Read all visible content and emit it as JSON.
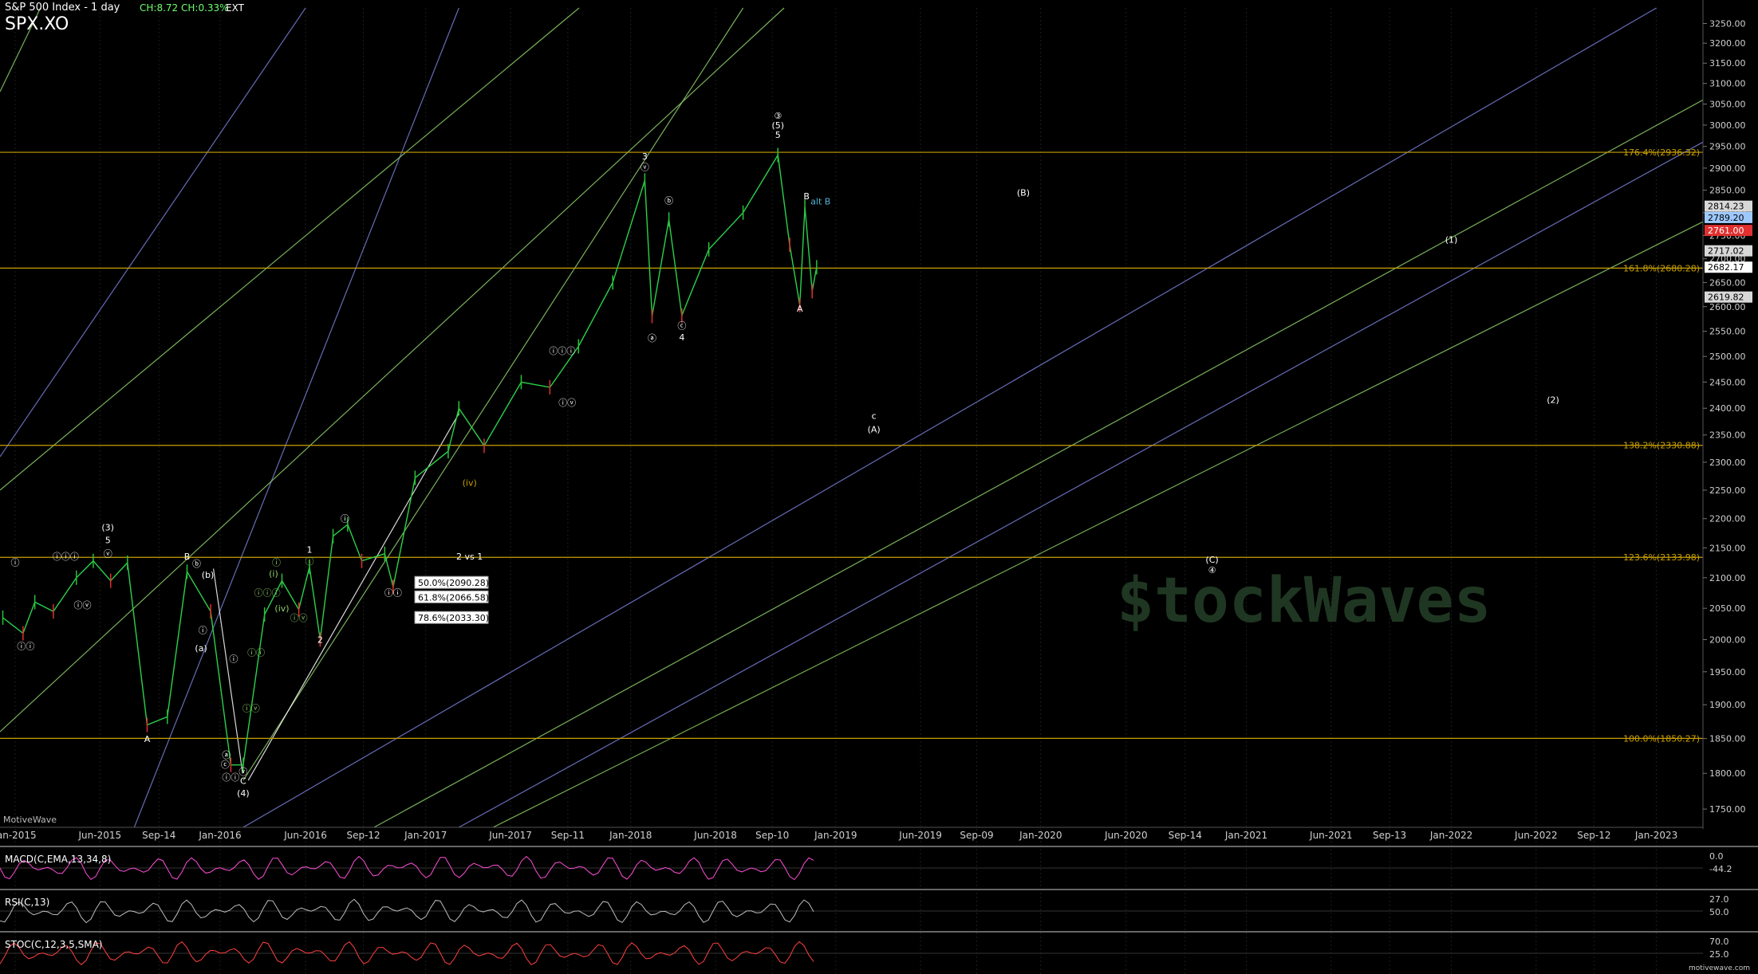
{
  "header": {
    "title": "S&P 500 Index - 1 day",
    "symbol": "SPX.XO",
    "change_points": "CH:8.72",
    "change_pct": "CH:0.33%",
    "session": "EXT"
  },
  "brand_label": "MotiveWave",
  "watermark_text": "motivewave.com",
  "logo_text": "$tockWaves",
  "colors": {
    "background": "#000000",
    "fib_line": "#c8a000",
    "up_bar": "#27c23a",
    "down_bar": "#e03030",
    "channel_green": "#8fd06a",
    "channel_blue": "#7a7fd8",
    "macd_line": "#ff4fd8",
    "macd_signal": "#4fa9ff",
    "rsi_line": "#bdbdbd",
    "stoch_line": "#ff4040"
  },
  "chart_data": {
    "type": "line",
    "title": "S&P 500 Index - 1 day",
    "y_scale": "log",
    "ylim": [
      1725,
      3290
    ],
    "xlim": [
      "2014-12-05",
      "2023-03-25"
    ],
    "y_ticks": [
      "3250.00",
      "3200.00",
      "3150.00",
      "3100.00",
      "3050.00",
      "3000.00",
      "2950.00",
      "2900.00",
      "2850.00",
      "2800.00",
      "2750.00",
      "2700.00",
      "2650.00",
      "2600.00",
      "2550.00",
      "2500.00",
      "2450.00",
      "2400.00",
      "2350.00",
      "2300.00",
      "2250.00",
      "2200.00",
      "2150.00",
      "2100.00",
      "2050.00",
      "2000.00",
      "1950.00",
      "1900.00",
      "1850.00",
      "1800.00",
      "1750.00"
    ],
    "x_ticks": [
      {
        "date": "2015-01-01",
        "label": "Jan-2015"
      },
      {
        "date": "2015-06-01",
        "label": "Jun-2015"
      },
      {
        "date": "2015-09-14",
        "label": "Sep-14"
      },
      {
        "date": "2016-01-01",
        "label": "Jan-2016"
      },
      {
        "date": "2016-06-01",
        "label": "Jun-2016"
      },
      {
        "date": "2016-09-12",
        "label": "Sep-12"
      },
      {
        "date": "2017-01-01",
        "label": "Jan-2017"
      },
      {
        "date": "2017-06-01",
        "label": "Jun-2017"
      },
      {
        "date": "2017-09-11",
        "label": "Sep-11"
      },
      {
        "date": "2018-01-01",
        "label": "Jan-2018"
      },
      {
        "date": "2018-06-01",
        "label": "Jun-2018"
      },
      {
        "date": "2018-09-10",
        "label": "Sep-10"
      },
      {
        "date": "2019-01-01",
        "label": "Jan-2019"
      },
      {
        "date": "2019-06-01",
        "label": "Jun-2019"
      },
      {
        "date": "2019-09-09",
        "label": "Sep-09"
      },
      {
        "date": "2020-01-01",
        "label": "Jan-2020"
      },
      {
        "date": "2020-06-01",
        "label": "Jun-2020"
      },
      {
        "date": "2020-09-14",
        "label": "Sep-14"
      },
      {
        "date": "2021-01-01",
        "label": "Jan-2021"
      },
      {
        "date": "2021-06-01",
        "label": "Jun-2021"
      },
      {
        "date": "2021-09-13",
        "label": "Sep-13"
      },
      {
        "date": "2022-01-01",
        "label": "Jan-2022"
      },
      {
        "date": "2022-06-01",
        "label": "Jun-2022"
      },
      {
        "date": "2022-09-12",
        "label": "Sep-12"
      },
      {
        "date": "2023-01-01",
        "label": "Jan-2023"
      }
    ],
    "price_series": [
      {
        "date": "2014-12-10",
        "value": 2035
      },
      {
        "date": "2015-01-15",
        "value": 2010
      },
      {
        "date": "2015-02-05",
        "value": 2060
      },
      {
        "date": "2015-03-10",
        "value": 2045
      },
      {
        "date": "2015-04-20",
        "value": 2100
      },
      {
        "date": "2015-05-20",
        "value": 2128
      },
      {
        "date": "2015-06-20",
        "value": 2095
      },
      {
        "date": "2015-07-20",
        "value": 2125
      },
      {
        "date": "2015-08-24",
        "value": 1870
      },
      {
        "date": "2015-09-29",
        "value": 1882
      },
      {
        "date": "2015-11-03",
        "value": 2110
      },
      {
        "date": "2015-12-15",
        "value": 2045
      },
      {
        "date": "2016-01-20",
        "value": 1812
      },
      {
        "date": "2016-02-11",
        "value": 1812
      },
      {
        "date": "2016-03-20",
        "value": 2040
      },
      {
        "date": "2016-04-20",
        "value": 2095
      },
      {
        "date": "2016-05-20",
        "value": 2048
      },
      {
        "date": "2016-06-08",
        "value": 2118
      },
      {
        "date": "2016-06-27",
        "value": 2000
      },
      {
        "date": "2016-07-20",
        "value": 2170
      },
      {
        "date": "2016-08-15",
        "value": 2190
      },
      {
        "date": "2016-09-09",
        "value": 2128
      },
      {
        "date": "2016-10-20",
        "value": 2140
      },
      {
        "date": "2016-11-04",
        "value": 2085
      },
      {
        "date": "2016-12-13",
        "value": 2272
      },
      {
        "date": "2017-02-10",
        "value": 2320
      },
      {
        "date": "2017-03-01",
        "value": 2400
      },
      {
        "date": "2017-04-15",
        "value": 2330
      },
      {
        "date": "2017-06-20",
        "value": 2450
      },
      {
        "date": "2017-08-10",
        "value": 2440
      },
      {
        "date": "2017-09-30",
        "value": 2520
      },
      {
        "date": "2017-11-30",
        "value": 2650
      },
      {
        "date": "2018-01-26",
        "value": 2872
      },
      {
        "date": "2018-02-08",
        "value": 2581
      },
      {
        "date": "2018-03-10",
        "value": 2785
      },
      {
        "date": "2018-04-02",
        "value": 2582
      },
      {
        "date": "2018-05-20",
        "value": 2720
      },
      {
        "date": "2018-07-20",
        "value": 2800
      },
      {
        "date": "2018-09-20",
        "value": 2930
      },
      {
        "date": "2018-10-11",
        "value": 2730
      },
      {
        "date": "2018-10-29",
        "value": 2603
      },
      {
        "date": "2018-11-07",
        "value": 2813
      },
      {
        "date": "2018-11-20",
        "value": 2632
      },
      {
        "date": "2018-11-28",
        "value": 2682
      }
    ],
    "fib_levels": [
      {
        "label": "176.4%(2936.32)",
        "value": 2936.32
      },
      {
        "label": "161.8%(2680.28)",
        "value": 2680.28
      },
      {
        "label": "138.2%(2330.88)",
        "value": 2330.88
      },
      {
        "label": "123.6%(2133.98)",
        "value": 2133.98
      },
      {
        "label": "100.0%(1850.27)",
        "value": 1850.27
      }
    ],
    "retrace_boxes": [
      {
        "label": "50.0%(2090.28)",
        "value": 2090.28
      },
      {
        "label": "61.8%(2066.58)",
        "value": 2066.58
      },
      {
        "label": "78.6%(2033.30)",
        "value": 2033.3
      }
    ],
    "price_tags": [
      {
        "label": "2814.23",
        "value": 2814.23,
        "color": "#d8d8d8",
        "text": "#000"
      },
      {
        "label": "2789.20",
        "value": 2789.2,
        "color": "#9ec9ff",
        "text": "#000"
      },
      {
        "label": "2761.00",
        "value": 2761.0,
        "color": "#e03030",
        "text": "#fff"
      },
      {
        "label": "2717.02",
        "value": 2717.02,
        "color": "#d8d8d8",
        "text": "#000"
      },
      {
        "label": "2682.17",
        "value": 2682.17,
        "color": "#ffffff",
        "text": "#000"
      },
      {
        "label": "2619.82",
        "value": 2619.82,
        "color": "#d8d8d8",
        "text": "#000"
      }
    ],
    "wave_labels": [
      {
        "text": "ⓘ",
        "date": "2015-01-01",
        "value": 2120,
        "color": "#ffffff"
      },
      {
        "text": "ⓘⓘ",
        "date": "2015-01-20",
        "value": 1985,
        "color": "#ffffff"
      },
      {
        "text": "ⓘⓘⓘ",
        "date": "2015-04-01",
        "value": 2130,
        "color": "#ffffff"
      },
      {
        "text": "ⓘⓥ",
        "date": "2015-05-01",
        "value": 2050,
        "color": "#ffffff"
      },
      {
        "text": "(3)",
        "date": "2015-06-15",
        "value": 2180,
        "color": "#ffffff"
      },
      {
        "text": "5",
        "date": "2015-06-15",
        "value": 2158,
        "color": "#ffffff"
      },
      {
        "text": "ⓥ",
        "date": "2015-06-15",
        "value": 2135,
        "color": "#ffffff"
      },
      {
        "text": "A",
        "date": "2015-08-24",
        "value": 1845,
        "color": "#ffffff"
      },
      {
        "text": "B",
        "date": "2015-11-03",
        "value": 2130,
        "color": "#ffffff"
      },
      {
        "text": "ⓑ",
        "date": "2015-11-20",
        "value": 2118,
        "color": "#ffffff"
      },
      {
        "text": "(b)",
        "date": "2015-12-10",
        "value": 2100,
        "color": "#ffffff"
      },
      {
        "text": "ⓘ",
        "date": "2015-12-01",
        "value": 2010,
        "color": "#ffffff"
      },
      {
        "text": "(a)",
        "date": "2015-11-28",
        "value": 1982,
        "color": "#ffffff"
      },
      {
        "text": "ⓘ",
        "date": "2016-01-25",
        "value": 1965,
        "color": "#ffffff"
      },
      {
        "text": "ⓐ",
        "date": "2016-01-12",
        "value": 1822,
        "color": "#ffffff"
      },
      {
        "text": "ⓒ",
        "date": "2016-01-10",
        "value": 1808,
        "color": "#ffffff"
      },
      {
        "text": "ⓥ",
        "date": "2016-02-11",
        "value": 1798,
        "color": "#ffffff"
      },
      {
        "text": "ⓘⓘ",
        "date": "2016-01-20",
        "value": 1790,
        "color": "#ffffff"
      },
      {
        "text": "C",
        "date": "2016-02-11",
        "value": 1785,
        "color": "#ffffff"
      },
      {
        "text": "(4)",
        "date": "2016-02-11",
        "value": 1768,
        "color": "#ffffff"
      },
      {
        "text": "ⓘⓘⓘ",
        "date": "2016-03-25",
        "value": 2070,
        "color": "#8fd06a"
      },
      {
        "text": "ⓘ",
        "date": "2016-04-10",
        "value": 2120,
        "color": "#8fd06a"
      },
      {
        "text": "(i)",
        "date": "2016-04-05",
        "value": 2102,
        "color": "#8fd06a"
      },
      {
        "text": "(iv)",
        "date": "2016-04-20",
        "value": 2045,
        "color": "#8fd06a"
      },
      {
        "text": "ⓘⓥ",
        "date": "2016-05-20",
        "value": 2030,
        "color": "#8fd06a"
      },
      {
        "text": "ⓘⓥ",
        "date": "2016-02-25",
        "value": 1890,
        "color": "#8fd06a"
      },
      {
        "text": "ⓘⓘ",
        "date": "2016-03-05",
        "value": 1975,
        "color": "#8fd06a"
      },
      {
        "text": "1",
        "date": "2016-06-08",
        "value": 2142,
        "color": "#ffffff"
      },
      {
        "text": "ⓘ",
        "date": "2016-06-08",
        "value": 2122,
        "color": "#8fd06a"
      },
      {
        "text": "2",
        "date": "2016-06-27",
        "value": 1995,
        "color": "#ffffff"
      },
      {
        "text": "ⓘ",
        "date": "2016-08-10",
        "value": 2195,
        "color": "#ffffff"
      },
      {
        "text": "ⓘⓘ",
        "date": "2016-11-04",
        "value": 2070,
        "color": "#ffffff"
      },
      {
        "text": "(iv)",
        "date": "2017-03-20",
        "value": 2258,
        "color": "#c8a000"
      },
      {
        "text": "2 vs 1",
        "date": "2017-03-20",
        "value": 2130,
        "color": "#ffffff"
      },
      {
        "text": "ⓘⓘⓘ",
        "date": "2017-09-01",
        "value": 2505,
        "color": "#ffffff"
      },
      {
        "text": "ⓘⓥ",
        "date": "2017-09-10",
        "value": 2405,
        "color": "#ffffff"
      },
      {
        "text": "3",
        "date": "2018-01-26",
        "value": 2920,
        "color": "#ffffff"
      },
      {
        "text": "ⓥ",
        "date": "2018-01-26",
        "value": 2895,
        "color": "#ffffff"
      },
      {
        "text": "ⓑ",
        "date": "2018-03-10",
        "value": 2820,
        "color": "#ffffff"
      },
      {
        "text": "ⓐ",
        "date": "2018-02-08",
        "value": 2530,
        "color": "#ffffff"
      },
      {
        "text": "ⓒ",
        "date": "2018-04-02",
        "value": 2555,
        "color": "#ffffff"
      },
      {
        "text": "4",
        "date": "2018-04-02",
        "value": 2532,
        "color": "#ffffff"
      },
      {
        "text": "③",
        "date": "2018-09-20",
        "value": 3015,
        "color": "#ffffff"
      },
      {
        "text": "(5)",
        "date": "2018-09-20",
        "value": 2992,
        "color": "#ffffff"
      },
      {
        "text": "5",
        "date": "2018-09-20",
        "value": 2970,
        "color": "#ffffff"
      },
      {
        "text": "B",
        "date": "2018-11-10",
        "value": 2830,
        "color": "#ffffff"
      },
      {
        "text": "alt B",
        "date": "2018-12-05",
        "value": 2818,
        "color": "#4fb4d8"
      },
      {
        "text": "A",
        "date": "2018-10-29",
        "value": 2590,
        "color": "#ffffff"
      },
      {
        "text": "c",
        "date": "2019-03-10",
        "value": 2380,
        "color": "#ffffff"
      },
      {
        "text": "(A)",
        "date": "2019-03-10",
        "value": 2355,
        "color": "#ffffff"
      },
      {
        "text": "(B)",
        "date": "2019-12-01",
        "value": 2838,
        "color": "#ffffff"
      },
      {
        "text": "(C)",
        "date": "2020-11-01",
        "value": 2125,
        "color": "#ffffff"
      },
      {
        "text": "④",
        "date": "2020-11-01",
        "value": 2108,
        "color": "#ffffff"
      },
      {
        "text": "(1)",
        "date": "2022-01-01",
        "value": 2734,
        "color": "#ffffff"
      },
      {
        "text": "(2)",
        "date": "2022-07-01",
        "value": 2410,
        "color": "#ffffff"
      }
    ],
    "channels": [
      {
        "start": [
          "2015-08-01",
          1725
        ],
        "end": [
          "2017-03-01",
          3290
        ],
        "color": "#7a7fd8"
      },
      {
        "start": [
          "2016-02-11",
          1790
        ],
        "end": [
          "2018-07-20",
          3290
        ],
        "color": "#8fd06a"
      },
      {
        "start": [
          "2014-12-05",
          1860
        ],
        "end": [
          "2018-10-01",
          3290
        ],
        "color": "#8fd06a"
      },
      {
        "start": [
          "2014-12-05",
          2250
        ],
        "end": [
          "2017-10-01",
          3290
        ],
        "color": "#8fd06a"
      },
      {
        "start": [
          "2014-12-05",
          3080
        ],
        "end": [
          "2015-02-15",
          3290
        ],
        "color": "#8fd06a"
      },
      {
        "start": [
          "2016-02-11",
          1725
        ],
        "end": [
          "2023-01-01",
          3290
        ],
        "color": "#7a7fd8"
      },
      {
        "start": [
          "2016-10-01",
          1725
        ],
        "end": [
          "2023-03-25",
          3060
        ],
        "color": "#8fd06a"
      },
      {
        "start": [
          "2017-05-01",
          1725
        ],
        "end": [
          "2023-03-25",
          2780
        ],
        "color": "#8fd06a"
      },
      {
        "start": [
          "2017-03-01",
          1725
        ],
        "end": [
          "2023-03-25",
          2960
        ],
        "color": "#7a7fd8"
      },
      {
        "start": [
          "2014-12-05",
          2310
        ],
        "end": [
          "2016-06-01",
          3290
        ],
        "color": "#7a7fd8"
      },
      {
        "start": [
          "2016-02-20",
          1790
        ],
        "end": [
          "2017-03-01",
          2390
        ],
        "color": "#ffffff"
      },
      {
        "start": [
          "2015-12-20",
          2115
        ],
        "end": [
          "2016-02-10",
          1800
        ],
        "color": "#ffffff"
      }
    ],
    "indicators": [
      {
        "name": "MACD(C,EMA,13,34,8)",
        "values": [
          0.0,
          -44.2
        ]
      },
      {
        "name": "RSI(C,13)",
        "values": [
          27.0,
          50.0
        ]
      },
      {
        "name": "STOC(C,12,3,5,SMA)",
        "values": [
          70.0,
          25.0
        ]
      }
    ]
  }
}
